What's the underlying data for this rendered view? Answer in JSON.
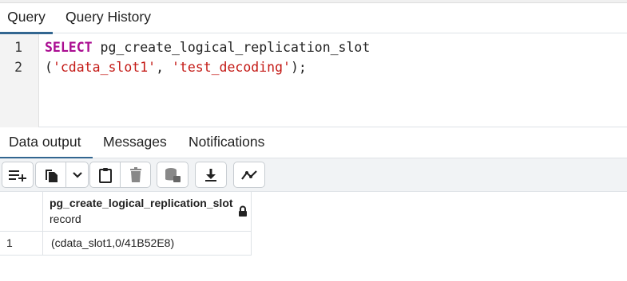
{
  "top_tabs": [
    {
      "label": "Query",
      "active": true
    },
    {
      "label": "Query History",
      "active": false
    }
  ],
  "editor": {
    "line_numbers": [
      "1",
      "2"
    ],
    "line1": {
      "keyword": "SELECT",
      "rest": " pg_create_logical_replication_slot"
    },
    "line2": {
      "open": "(",
      "arg1": "'cdata_slot1'",
      "sep": ", ",
      "arg2": "'test_decoding'",
      "close": ");"
    }
  },
  "result_tabs": [
    {
      "label": "Data output",
      "active": true
    },
    {
      "label": "Messages",
      "active": false
    },
    {
      "label": "Notifications",
      "active": false
    }
  ],
  "toolbar": {
    "icons": [
      "add-row-icon",
      "copy-icon",
      "chevron-down-icon",
      "paste-icon",
      "delete-icon",
      "save-data-icon",
      "download-icon",
      "graph-icon"
    ]
  },
  "grid": {
    "columns": [
      {
        "name": "pg_create_logical_replication_slot",
        "type": "record",
        "locked": true
      }
    ],
    "rows": [
      {
        "num": "1",
        "cells": [
          "(cdata_slot1,0/41B52E8)"
        ]
      }
    ]
  },
  "colors": {
    "keyword": "#aa0d91",
    "string": "#c41a16",
    "active_tab_underline": "#326690"
  }
}
